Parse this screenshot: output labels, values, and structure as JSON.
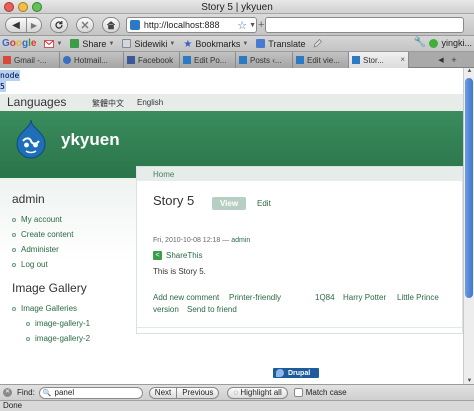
{
  "window": {
    "title": "Story 5 | ykyuen"
  },
  "navbar": {
    "back_symbol": "◀",
    "forward_symbol": "▶",
    "url": "http://localhost:888",
    "url_star": "☆",
    "url_dropdown": "▼",
    "add_symbol": "+"
  },
  "bookmarks_bar": {
    "google_logo": [
      "G",
      "o",
      "o",
      "g",
      "l",
      "e"
    ],
    "items": [
      {
        "label": "Share",
        "icon_color": "#3b9c4a"
      },
      {
        "label": "Sidewiki",
        "icon_color": "#cfd8e3"
      },
      {
        "label": "Bookmarks",
        "icon_color": "#3b5fc0"
      },
      {
        "label": "Translate",
        "icon_color": "#4a7ad0"
      }
    ],
    "user_label": "yingki..."
  },
  "tabs": [
    {
      "label": "Gmail -...",
      "favicon_color": "#d74a3b",
      "active": false
    },
    {
      "label": "Hotmail...",
      "favicon_color": "#3a6fc4",
      "active": false
    },
    {
      "label": "Facebook",
      "favicon_color": "#3b5998",
      "active": false
    },
    {
      "label": "Edit Po...",
      "favicon_color": "#2d7ac4",
      "active": false
    },
    {
      "label": "Posts ‹...",
      "favicon_color": "#2d7ac4",
      "active": false
    },
    {
      "label": "Edit vie...",
      "favicon_color": "#2d7ac4",
      "active": false
    },
    {
      "label": "Stor...",
      "favicon_color": "#2d7ac4",
      "active": true,
      "close": "×"
    }
  ],
  "tab_controls": {
    "scroll_left": "◀",
    "new_tab": "+"
  },
  "page": {
    "selected_lines": [
      "node",
      "5"
    ],
    "languages": {
      "title": "Languages",
      "links": [
        "繁體中文",
        "English"
      ]
    },
    "site_name": "ykyuen",
    "sidebar": {
      "user_block_title": "admin",
      "user_links": [
        "My account",
        "Create content",
        "Administer",
        "Log out"
      ],
      "gallery_title": "Image Gallery",
      "gallery_root": "Image Galleries",
      "gallery_children": [
        "image-gallery-1",
        "image-gallery-2"
      ]
    },
    "main": {
      "breadcrumb": "Home",
      "title": "Story 5",
      "tab_view": "View",
      "tab_edit": "Edit",
      "submitted_date": "Fri, 2010-10-08 12:18 — ",
      "submitted_author": "admin",
      "sharethis_label": "ShareThis",
      "body": "This is Story 5.",
      "links_row1": [
        "Add new comment",
        "Printer-friendly",
        "1Q84",
        "Harry Potter",
        "Little Prince"
      ],
      "links_row2": [
        "version",
        "Send to friend"
      ]
    },
    "powered_by": "Drupal"
  },
  "findbar": {
    "close": "✕",
    "label": "Find:",
    "value": "panel",
    "next": "Next",
    "previous": "Previous",
    "highlight_all": "Highlight all",
    "match_case": "Match case"
  },
  "status": "Done",
  "colors": {
    "header_green": "#3a8c5e",
    "link_green": "#2b6a44",
    "selection_blue": "#b5d2f5"
  }
}
